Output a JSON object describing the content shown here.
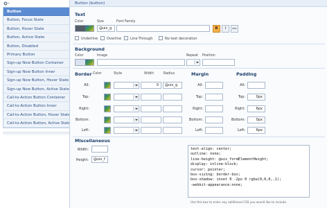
{
  "sidebar": {
    "items": [
      {
        "label": "Button",
        "active": true
      },
      {
        "label": "Button, Focus State"
      },
      {
        "label": "Button, Hover State"
      },
      {
        "label": "Button, Active State"
      },
      {
        "label": "Button, Disabled"
      },
      {
        "label": "Primary Button"
      },
      {
        "label": "Sign-up Now Button Container"
      },
      {
        "label": "Sign-up Now Button Inner"
      },
      {
        "label": "Sign-up Now Button, Hover State"
      },
      {
        "label": "Sign-up Now Button, Active State"
      },
      {
        "label": "Call-to-Action Button Container"
      },
      {
        "label": "Call-to-Action Button Inner"
      },
      {
        "label": "Call-to-Action Button, Hover State"
      },
      {
        "label": "Call-to-Action Button, Active State"
      }
    ]
  },
  "header": {
    "title": "Button (button)"
  },
  "text_section": {
    "title": "Text",
    "color_label": "Color",
    "size_label": "Size",
    "size_value": "@uix_g",
    "font_family_label": "Font Family",
    "font_family_value": "",
    "bold_label": "B",
    "italic_label": "I",
    "other_label": "abc",
    "underline": "Underline",
    "overline": "Overline",
    "line_through": "Line-Through",
    "no_decoration": "No text decoration"
  },
  "background_section": {
    "title": "Background",
    "color_label": "Color",
    "image_label": "Image",
    "image_value": "",
    "repeat_label": "Repeat",
    "position_label": "Position",
    "position_value": ""
  },
  "border_section": {
    "title": "Border",
    "color_label": "Color",
    "style_label": "Style",
    "width_label": "Width",
    "radius_label": "Radius",
    "rows": [
      {
        "label": "All:",
        "width": "0",
        "radius": "@uix_g"
      },
      {
        "label": "Top:",
        "width": "",
        "radius": ""
      },
      {
        "label": "Right:",
        "width": "",
        "radius": ""
      },
      {
        "label": "Bottom:",
        "width": "",
        "radius": ""
      },
      {
        "label": "Left:",
        "width": "",
        "radius": ""
      }
    ]
  },
  "margin_section": {
    "title": "Margin",
    "rows": [
      {
        "label": "All:",
        "value": ""
      },
      {
        "label": "Top:",
        "value": ""
      },
      {
        "label": "Right:",
        "value": ""
      },
      {
        "label": "Bottom:",
        "value": ""
      },
      {
        "label": "Left:",
        "value": ""
      }
    ]
  },
  "padding_section": {
    "title": "Padding",
    "rows": [
      {
        "label": "All:",
        "value": ""
      },
      {
        "label": "Top:",
        "value": "0px"
      },
      {
        "label": "Right:",
        "value": "6px"
      },
      {
        "label": "Bottom:",
        "value": "0px"
      },
      {
        "label": "Left:",
        "value": "6px"
      }
    ]
  },
  "misc_section": {
    "title": "Miscellaneous",
    "width_label": "Width:",
    "width_value": "",
    "height_label": "Height:",
    "height_value": "@uix_f",
    "css_lines": [
      "text-align: center;",
      "outline: none;",
      "line-height: @uix_formElementHeight;",
      "display: inline-block;",
      "cursor: pointer;",
      "box-sizing: border-box;",
      "box-shadow: inset 0 -2px 0 rgba(0,0,0,.1);",
      "-webkit-appearance:none;"
    ],
    "hint": "Use this box to enter any additional CSS you would like to include."
  },
  "colors": {
    "accent": "#5b8bd2",
    "title_text": "#1d3e6b",
    "bold_button": "#f4b04a"
  }
}
